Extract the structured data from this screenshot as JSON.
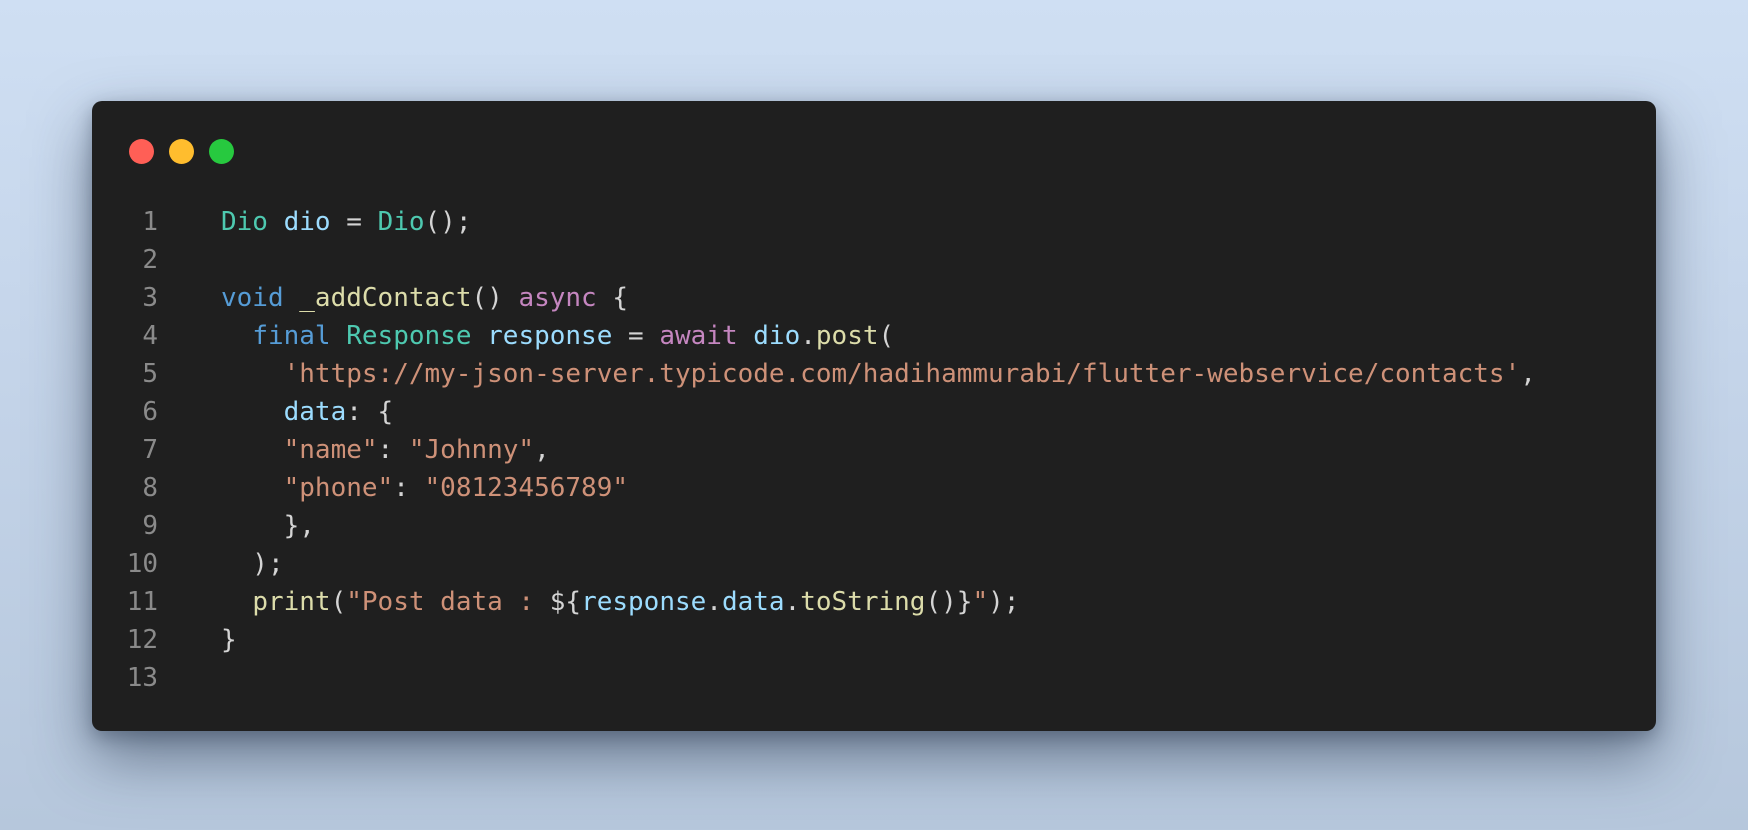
{
  "window": {
    "controls": [
      "close",
      "minimize",
      "maximize"
    ],
    "colors": {
      "close": "#ff5f56",
      "minimize": "#ffbd2e",
      "maximize": "#27c93f",
      "background": "#1f1f1f"
    }
  },
  "theme": {
    "type": "#4ec9b0",
    "variable": "#9cdcfe",
    "keyword": "#569cd6",
    "control": "#c586c0",
    "function": "#dcdcaa",
    "string": "#ce9178",
    "punctuation": "#d4d4d4",
    "line_number": "#8a8a8a"
  },
  "code": {
    "line_numbers": [
      "1",
      "2",
      "3",
      "4",
      "5",
      "6",
      "7",
      "8",
      "9",
      "10",
      "11",
      "12",
      "13"
    ],
    "lines": [
      [
        {
          "text": "Dio",
          "kind": "type"
        },
        {
          "text": " ",
          "kind": "punctuation"
        },
        {
          "text": "dio",
          "kind": "variable"
        },
        {
          "text": " = ",
          "kind": "punctuation"
        },
        {
          "text": "Dio",
          "kind": "type"
        },
        {
          "text": "();",
          "kind": "punctuation"
        }
      ],
      [],
      [
        {
          "text": "void",
          "kind": "keyword"
        },
        {
          "text": " ",
          "kind": "punctuation"
        },
        {
          "text": "_addContact",
          "kind": "function"
        },
        {
          "text": "() ",
          "kind": "punctuation"
        },
        {
          "text": "async",
          "kind": "control"
        },
        {
          "text": " {",
          "kind": "punctuation"
        }
      ],
      [
        {
          "text": "  ",
          "kind": "punctuation"
        },
        {
          "text": "final",
          "kind": "keyword"
        },
        {
          "text": " ",
          "kind": "punctuation"
        },
        {
          "text": "Response",
          "kind": "type"
        },
        {
          "text": " ",
          "kind": "punctuation"
        },
        {
          "text": "response",
          "kind": "variable"
        },
        {
          "text": " = ",
          "kind": "punctuation"
        },
        {
          "text": "await",
          "kind": "control"
        },
        {
          "text": " ",
          "kind": "punctuation"
        },
        {
          "text": "dio",
          "kind": "variable"
        },
        {
          "text": ".",
          "kind": "punctuation"
        },
        {
          "text": "post",
          "kind": "function"
        },
        {
          "text": "(",
          "kind": "punctuation"
        }
      ],
      [
        {
          "text": "    ",
          "kind": "punctuation"
        },
        {
          "text": "'https://my-json-server.typicode.com/hadihammurabi/flutter-webservice/contacts'",
          "kind": "string"
        },
        {
          "text": ",",
          "kind": "punctuation"
        }
      ],
      [
        {
          "text": "    ",
          "kind": "punctuation"
        },
        {
          "text": "data",
          "kind": "variable"
        },
        {
          "text": ": {",
          "kind": "punctuation"
        }
      ],
      [
        {
          "text": "    ",
          "kind": "punctuation"
        },
        {
          "text": "\"name\"",
          "kind": "string"
        },
        {
          "text": ": ",
          "kind": "punctuation"
        },
        {
          "text": "\"Johnny\"",
          "kind": "string"
        },
        {
          "text": ",",
          "kind": "punctuation"
        }
      ],
      [
        {
          "text": "    ",
          "kind": "punctuation"
        },
        {
          "text": "\"phone\"",
          "kind": "string"
        },
        {
          "text": ": ",
          "kind": "punctuation"
        },
        {
          "text": "\"08123456789\"",
          "kind": "string"
        }
      ],
      [
        {
          "text": "    },",
          "kind": "punctuation"
        }
      ],
      [
        {
          "text": "  );",
          "kind": "punctuation"
        }
      ],
      [
        {
          "text": "  ",
          "kind": "punctuation"
        },
        {
          "text": "print",
          "kind": "function"
        },
        {
          "text": "(",
          "kind": "punctuation"
        },
        {
          "text": "\"Post data : ",
          "kind": "string"
        },
        {
          "text": "${",
          "kind": "punctuation"
        },
        {
          "text": "response",
          "kind": "variable"
        },
        {
          "text": ".",
          "kind": "punctuation"
        },
        {
          "text": "data",
          "kind": "variable"
        },
        {
          "text": ".",
          "kind": "punctuation"
        },
        {
          "text": "toString",
          "kind": "function"
        },
        {
          "text": "()}",
          "kind": "punctuation"
        },
        {
          "text": "\"",
          "kind": "string"
        },
        {
          "text": ");",
          "kind": "punctuation"
        }
      ],
      [
        {
          "text": "}",
          "kind": "punctuation"
        }
      ],
      []
    ]
  }
}
